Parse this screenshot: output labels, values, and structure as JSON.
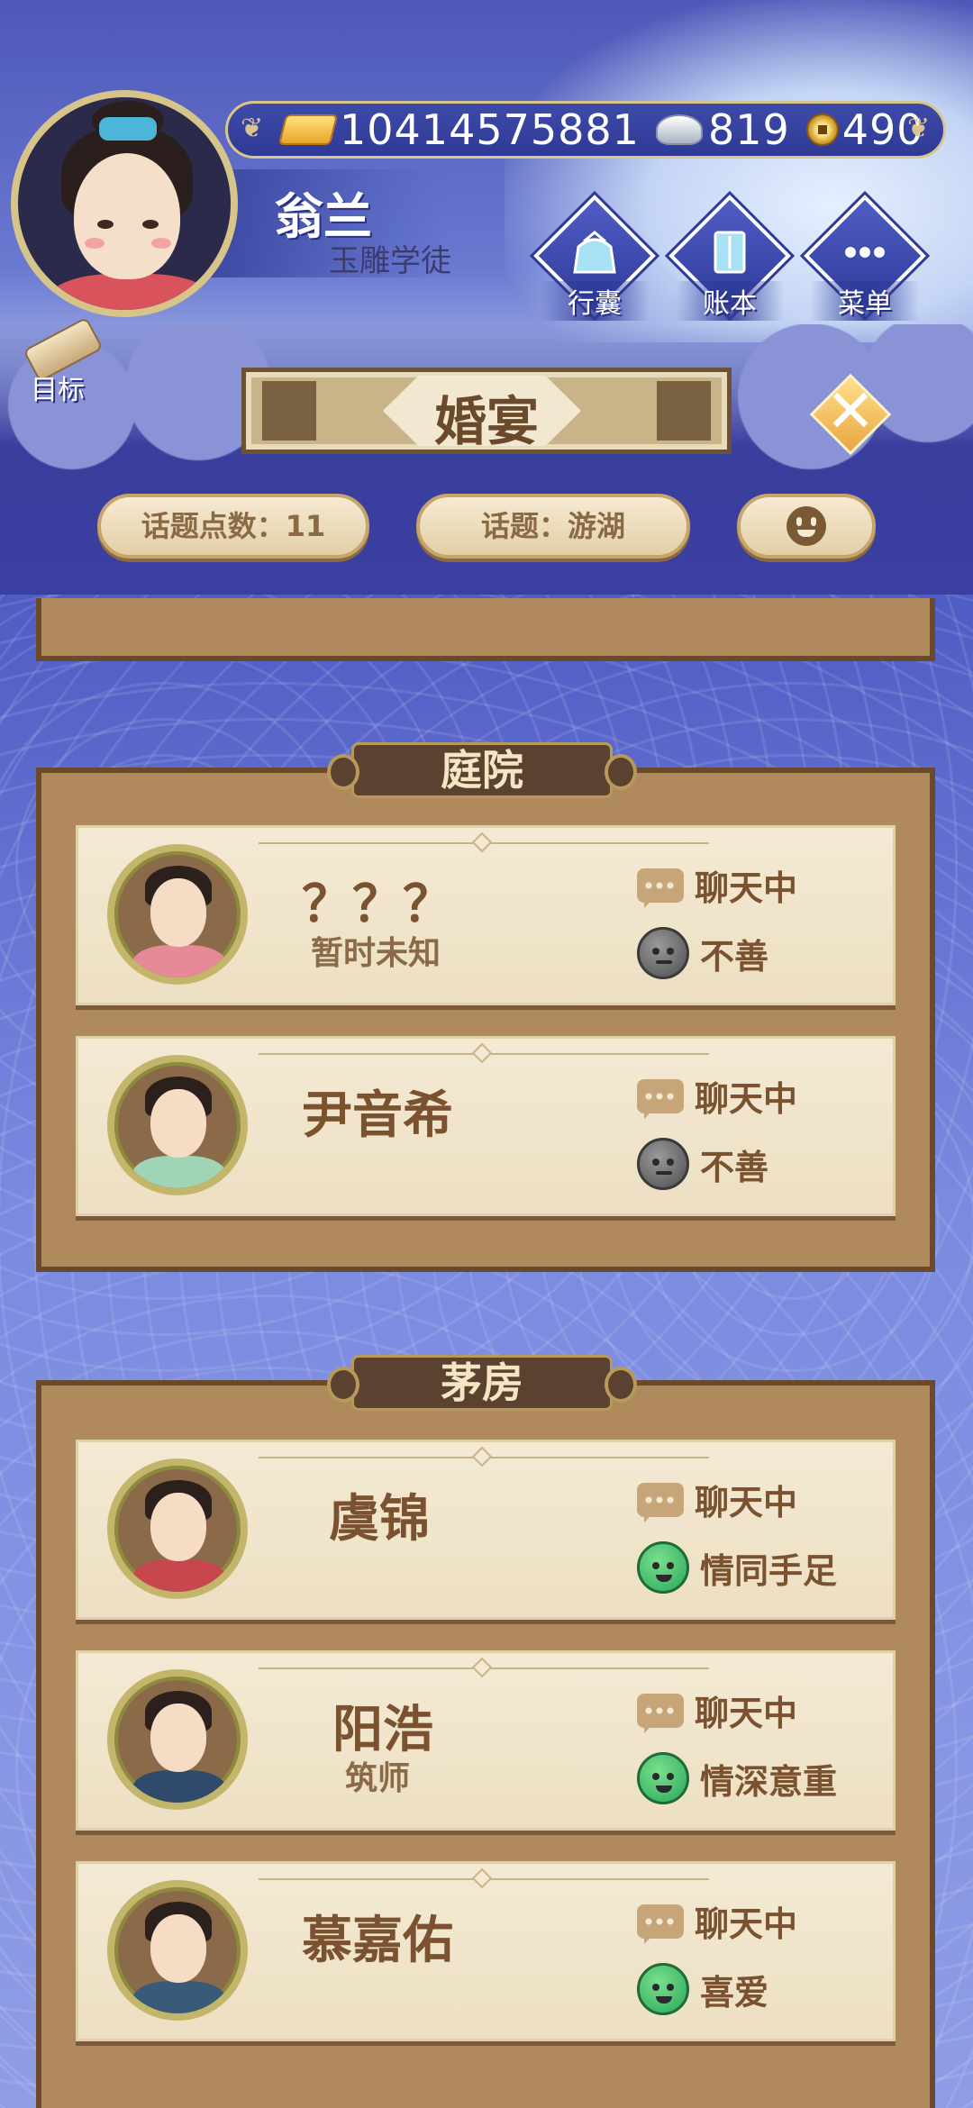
{
  "header": {
    "resources": {
      "gold": "10414575881",
      "silver": "819",
      "coin": "490"
    },
    "player": {
      "name": "翁兰",
      "title": "玉雕学徒"
    },
    "menu_buttons": [
      {
        "label": "行囊",
        "icon": "bag-icon"
      },
      {
        "label": "账本",
        "icon": "ledger-icon"
      },
      {
        "label": "菜单",
        "icon": "more-icon"
      }
    ],
    "goal_label": "目标",
    "page_title": "婚宴"
  },
  "toolbar": {
    "topic_points": "话题点数：11",
    "topic": "话题：游湖",
    "emoji_icon": "smile-icon"
  },
  "sections": [
    {
      "title": "庭院",
      "guests": [
        {
          "name": "？？？",
          "subtitle": "暂时未知",
          "status": "聊天中",
          "mood": "不善",
          "mood_type": "bad"
        },
        {
          "name": "尹音希",
          "subtitle": "",
          "status": "聊天中",
          "mood": "不善",
          "mood_type": "bad"
        }
      ]
    },
    {
      "title": "茅房",
      "guests": [
        {
          "name": "虞锦",
          "subtitle": "",
          "status": "聊天中",
          "mood": "情同手足",
          "mood_type": "good"
        },
        {
          "name": "阳浩",
          "subtitle": "筑师",
          "status": "聊天中",
          "mood": "情深意重",
          "mood_type": "good"
        },
        {
          "name": "慕嘉佑",
          "subtitle": "",
          "status": "聊天中",
          "mood": "喜爱",
          "mood_type": "good"
        }
      ]
    }
  ],
  "colors": {
    "panel": "#b08a5c",
    "card": "#f4ead4",
    "accent_gold": "#d9c68c",
    "bad_mood": "#6b6b6b",
    "good_mood": "#3cc46b"
  }
}
